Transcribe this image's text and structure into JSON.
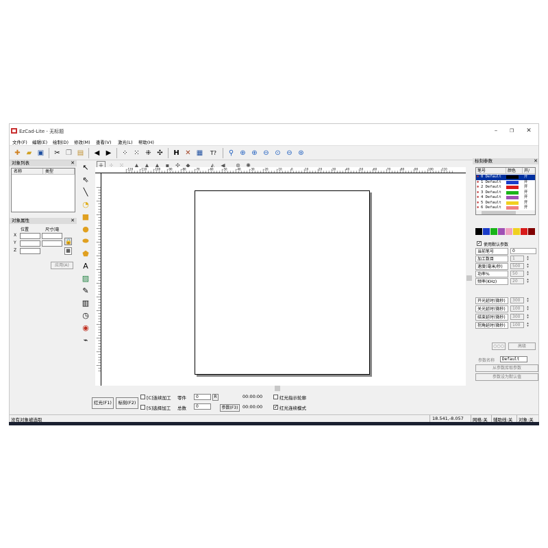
{
  "window": {
    "app_name": "EzCad-Lite",
    "doc_title": " - 无标题"
  },
  "menu": [
    "文件(F)",
    "编辑(E)",
    "绘制(D)",
    "修改(M)",
    "查看(V)",
    "激光(L)",
    "帮助(H)"
  ],
  "toolbar_icons": [
    "new-icon",
    "open-icon",
    "save-icon",
    "cut-icon",
    "copy-icon",
    "paste-icon",
    "undo-icon",
    "redo-icon",
    "select-all-icon",
    "invert-select-icon",
    "align-icon",
    "node-icon",
    "h-icon",
    "cross-icon",
    "text-icon",
    "zoom-in-icon"
  ],
  "object_list": {
    "title": "对象列表",
    "col_name": "名称",
    "col_type": "类型"
  },
  "object_props": {
    "title": "对象属性",
    "col_position": "位置",
    "col_size": "尺寸(毫",
    "axis_x": "X",
    "axis_y": "Y",
    "axis_z": "Z",
    "apply_label": "应用(A)"
  },
  "bottom": {
    "red_label": "红光(F1)",
    "mark_label": "标刻(F2)",
    "continuous_label": "[C]连续加工",
    "part_label": "零件",
    "part_value": "0",
    "r_label": "R",
    "time1": "00:00:00",
    "red_outline_label": "红光指示轮廓",
    "selected_label": "[S]选择加工",
    "total_label": "总数",
    "total_value": "0",
    "params_label": "参数(F3)",
    "time2": "00:00:00",
    "red_continuous_label": "红光连续模式"
  },
  "status": {
    "message": "没有对象被选取",
    "coords": "18.541,-8.057",
    "grid": "网格:关",
    "guide": "辅助线:关",
    "object": "对象:关"
  },
  "right_panel": {
    "title": "标刻参数",
    "col_pen": "笔号",
    "col_color": "颜色",
    "col_onoff": "开/",
    "pens": [
      {
        "label": "0 Default",
        "color": "#000000",
        "state": "开"
      },
      {
        "label": "1 Default",
        "color": "#1a3cc8",
        "state": "开"
      },
      {
        "label": "2 Default",
        "color": "#d81a1a",
        "state": "开"
      },
      {
        "label": "3 Default",
        "color": "#1ab41a",
        "state": "开"
      },
      {
        "label": "4 Default",
        "color": "#a050b4",
        "state": "开"
      },
      {
        "label": "5 Default",
        "color": "#f0d020",
        "state": "开"
      },
      {
        "label": "6 Default",
        "color": "#f08080",
        "state": "开"
      }
    ],
    "palette": [
      "#000000",
      "#1a3cc8",
      "#1ab41a",
      "#a050b4",
      "#f0a0c0",
      "#f0d020",
      "#d81a1a",
      "#800000"
    ],
    "use_default_label": "使用默认参数",
    "params": [
      {
        "label": "当前笔号",
        "value": "0"
      },
      {
        "label": "加工数目",
        "value": "1"
      },
      {
        "label": "速度(毫米/秒)",
        "value": "500"
      },
      {
        "label": "功率%",
        "value": "50"
      },
      {
        "label": "频率(KHz)",
        "value": "20"
      }
    ],
    "delays": [
      {
        "label": "开光延时(微秒)",
        "value": "300"
      },
      {
        "label": "关光延时(微秒)",
        "value": "100"
      },
      {
        "label": "结束延时(微秒)",
        "value": "300"
      },
      {
        "label": "拐角延时(微秒)",
        "value": "100"
      }
    ],
    "advanced_label": "高级",
    "param_name_label": "参数名称",
    "param_name_value": "Default",
    "load_from_lib_label": "从参数库取参数",
    "set_default_label": "参数设为默认值"
  },
  "ruler_ticks": [
    "-120",
    "-110",
    "-100",
    "-90",
    "-80",
    "-70",
    "-60",
    "-50",
    "-40",
    "-30",
    "-20",
    "-10",
    "0",
    "10",
    "20",
    "30",
    "40",
    "50",
    "60",
    "70",
    "80",
    "90",
    "100",
    "110"
  ]
}
